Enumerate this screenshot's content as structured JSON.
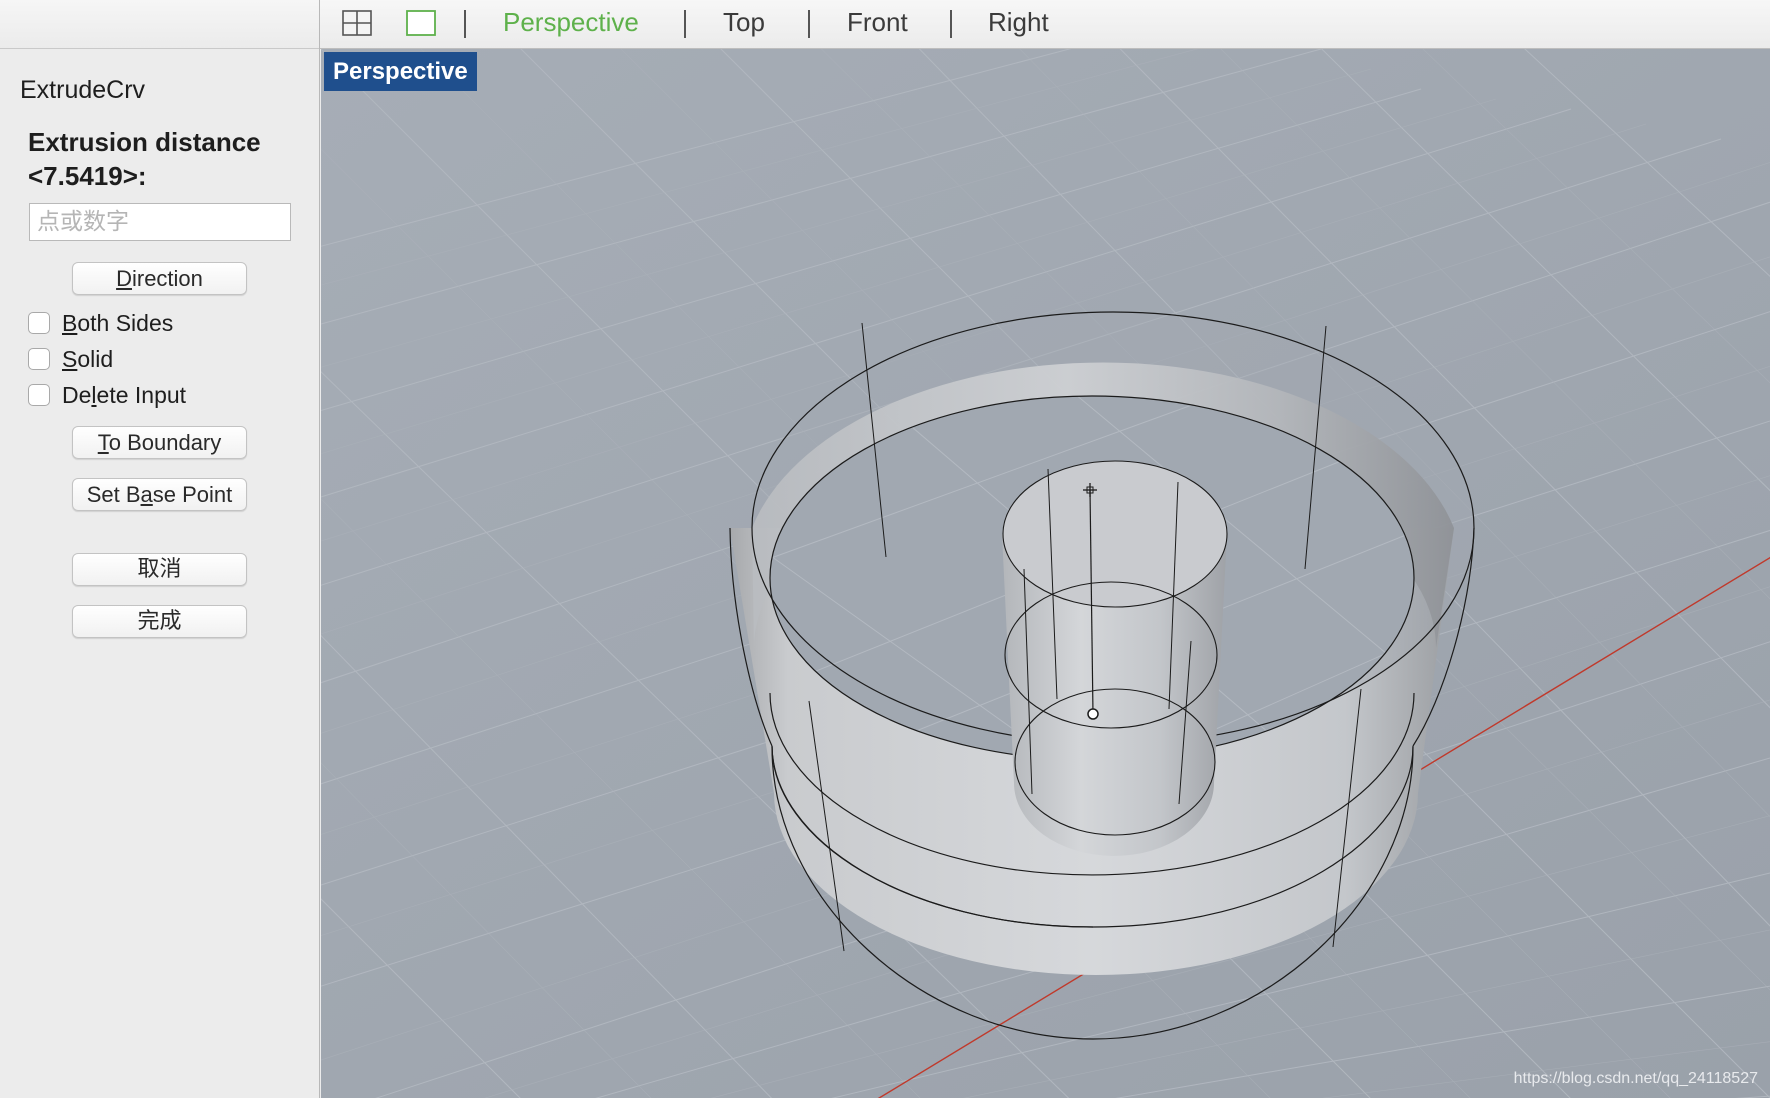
{
  "panel": {
    "command_name": "ExtrudeCrv",
    "prompt": "Extrusion distance <7.5419>:",
    "input_placeholder": "点或数字",
    "buttons": {
      "direction": {
        "pre": "",
        "u": "D",
        "post": "irection"
      },
      "to_boundary": {
        "pre": "",
        "u": "T",
        "post": "o Boundary"
      },
      "set_base_point": {
        "pre": "Set B",
        "u": "a",
        "post": "se Point"
      },
      "cancel": "取消",
      "done": "完成"
    },
    "options": [
      {
        "pre": "",
        "u": "B",
        "post": "oth Sides",
        "checked": false
      },
      {
        "pre": "",
        "u": "S",
        "post": "olid",
        "checked": false
      },
      {
        "pre": "De",
        "u": "l",
        "post": "ete Input",
        "checked": false
      }
    ]
  },
  "tabs": [
    {
      "label": "Perspective",
      "active": true
    },
    {
      "label": "Top",
      "active": false
    },
    {
      "label": "Front",
      "active": false
    },
    {
      "label": "Right",
      "active": false
    }
  ],
  "viewport": {
    "label": "Perspective",
    "watermark": "https://blog.csdn.net/qq_24118527"
  },
  "colors": {
    "active_tab": "#5eb14b",
    "viewport_label_bg": "#1f4f8d",
    "viewport_bg": "#a2a9b2",
    "x_axis": "#c0392b"
  },
  "icons": [
    "four-viewports-icon",
    "single-viewport-icon"
  ]
}
